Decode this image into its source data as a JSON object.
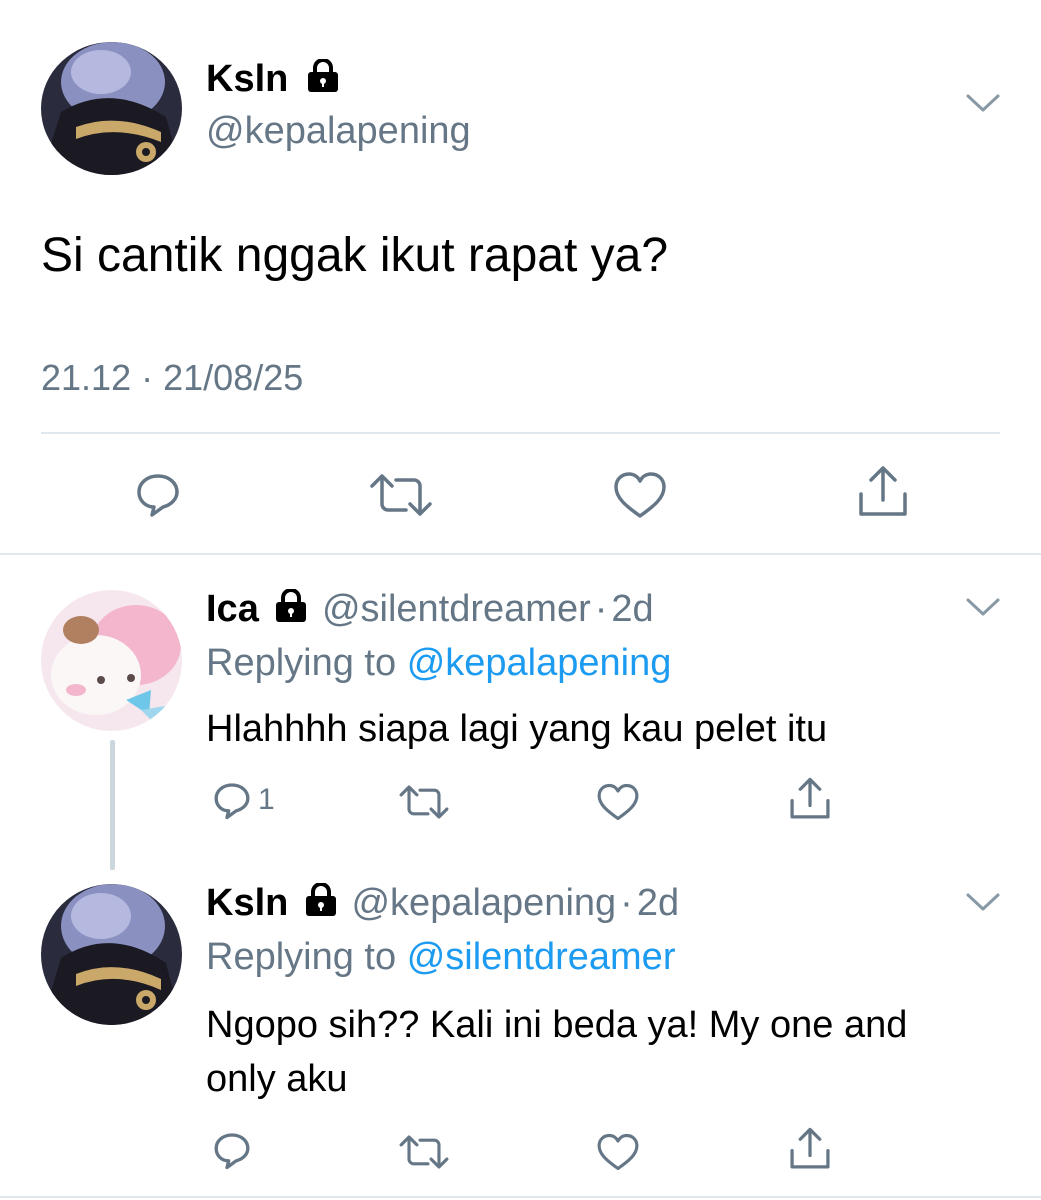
{
  "main_tweet": {
    "display_name": "Ksln",
    "handle": "@kepalapening",
    "text": "Si cantik nggak ikut rapat ya?",
    "time": "21.12",
    "date": "21/08/25",
    "separator": "·",
    "locked_icon": "lock-icon"
  },
  "replies": [
    {
      "display_name": "Ica",
      "handle": "@silentdreamer",
      "age": "2d",
      "separator": "·",
      "replying_prefix": "Replying to",
      "replying_to": "@kepalapening",
      "text": "Hlahhhh siapa lagi yang kau pelet itu",
      "reply_count": "1"
    },
    {
      "display_name": "Ksln",
      "handle": "@kepalapening",
      "age": "2d",
      "separator": "·",
      "replying_prefix": "Replying to",
      "replying_to": "@silentdreamer",
      "text_line1": "Ngopo sih?? Kali ini beda ya! My one and",
      "text_line2": "only aku",
      "reply_count": ""
    }
  ],
  "colors": {
    "text_grey": "#657786",
    "link_blue": "#1d9bf0",
    "divider": "#e1e8ed",
    "icon_grey": "#657786"
  },
  "icons": [
    "reply-icon",
    "retweet-icon",
    "like-icon",
    "share-icon",
    "chevron-down-icon",
    "lock-icon"
  ]
}
